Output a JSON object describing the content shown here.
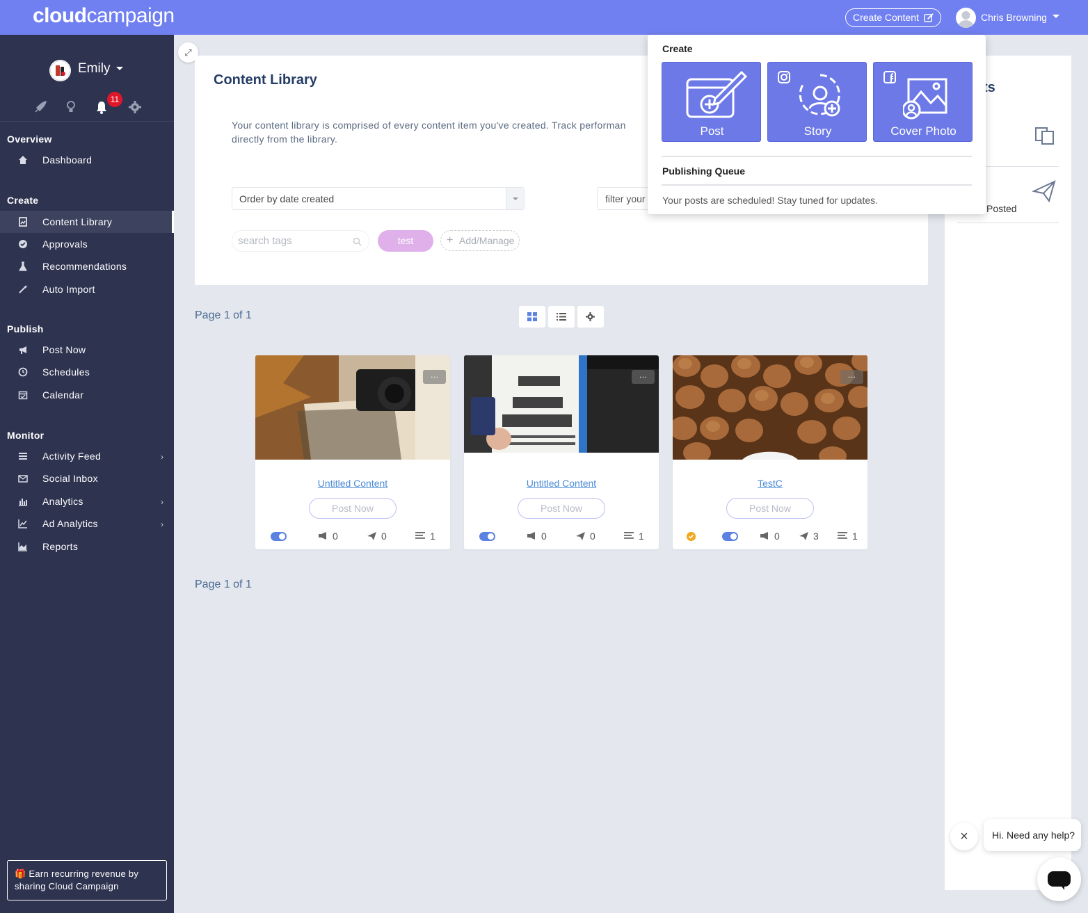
{
  "header": {
    "logo_bold": "cloud",
    "logo_light": "campaign",
    "create_content_label": "Create Content",
    "user_name": "Chris Browning"
  },
  "sidebar": {
    "account_name": "Emily",
    "notification_count": "11",
    "sections": {
      "overview": "Overview",
      "create": "Create",
      "publish": "Publish",
      "monitor": "Monitor"
    },
    "items": {
      "dashboard": "Dashboard",
      "content_library": "Content Library",
      "approvals": "Approvals",
      "recommendations": "Recommendations",
      "auto_import": "Auto Import",
      "post_now": "Post Now",
      "schedules": "Schedules",
      "calendar": "Calendar",
      "activity_feed": "Activity Feed",
      "social_inbox": "Social Inbox",
      "analytics": "Analytics",
      "ad_analytics": "Ad Analytics",
      "reports": "Reports"
    },
    "earn_text": "Earn recurring revenue by sharing Cloud Campaign"
  },
  "library": {
    "title": "Content Library",
    "description_line1": "Your content library is comprised of every content item you've created. Track performan",
    "description_line2": "directly from the library.",
    "order_select_value": "Order by date created",
    "filter_placeholder": "filter your",
    "search_tags_placeholder": "search tags",
    "tag": "test",
    "add_manage": "Add/Manage",
    "page_top": "Page 1 of 1",
    "page_bottom": "Page 1 of 1"
  },
  "cards": [
    {
      "title": "Untitled Content",
      "post_now": "Post Now",
      "approved": false,
      "toggle_on": true,
      "boosts": "0",
      "posts": "0",
      "items": "1"
    },
    {
      "title": "Untitled Content",
      "post_now": "Post Now",
      "approved": false,
      "toggle_on": true,
      "boosts": "0",
      "posts": "0",
      "items": "1"
    },
    {
      "title": "TestC",
      "post_now": "Post Now",
      "approved": true,
      "toggle_on": true,
      "boosts": "0",
      "posts": "3",
      "items": "1"
    }
  ],
  "thumbs": {
    "card_1": "camera-and-autumn-leaves",
    "card_2": "parking-receipt",
    "card_3": "walnuts"
  },
  "right_panel": {
    "title_fragment": "ts",
    "posted_label": "Posted"
  },
  "dropdown": {
    "create_heading": "Create",
    "tiles": [
      "Post",
      "Story",
      "Cover Photo"
    ],
    "queue_heading": "Publishing Queue",
    "queue_message": "Your posts are scheduled! Stay tuned for updates."
  },
  "help": {
    "message": "Hi. Need any help?"
  },
  "colors": {
    "topbar": "#7180f0",
    "sidebar": "#2e3350",
    "tile": "#6c79e6",
    "badge": "#e0162b",
    "link": "#4b8bd8"
  }
}
